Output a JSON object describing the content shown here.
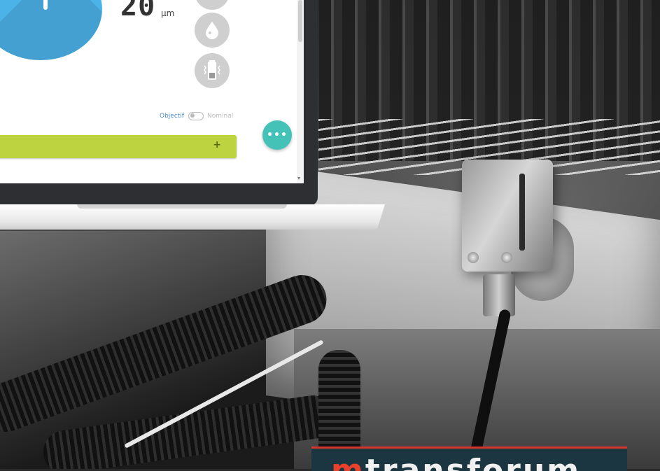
{
  "screen": {
    "measurement": {
      "value": "20",
      "unit": "µm"
    },
    "sun_icon": "sun-icon",
    "side_icons": [
      "gauge-icon",
      "humidity-drop-icon",
      "battery-vibration-icon"
    ],
    "toggle": {
      "left_label": "Objectif",
      "right_label": "Nominal",
      "state": "off"
    },
    "fab_label": "•••",
    "add_bar_label": "+",
    "scroll_arrow": "▾"
  },
  "logo": {
    "part1": "m",
    "part2": "transforum"
  },
  "colors": {
    "sun_bg": "#4bb3e8",
    "sun": "#f6cf2c",
    "fab": "#44c2b8",
    "add_bar": "#bed340",
    "logo_bg": "#1c3641",
    "logo_accent": "#e8412d"
  }
}
